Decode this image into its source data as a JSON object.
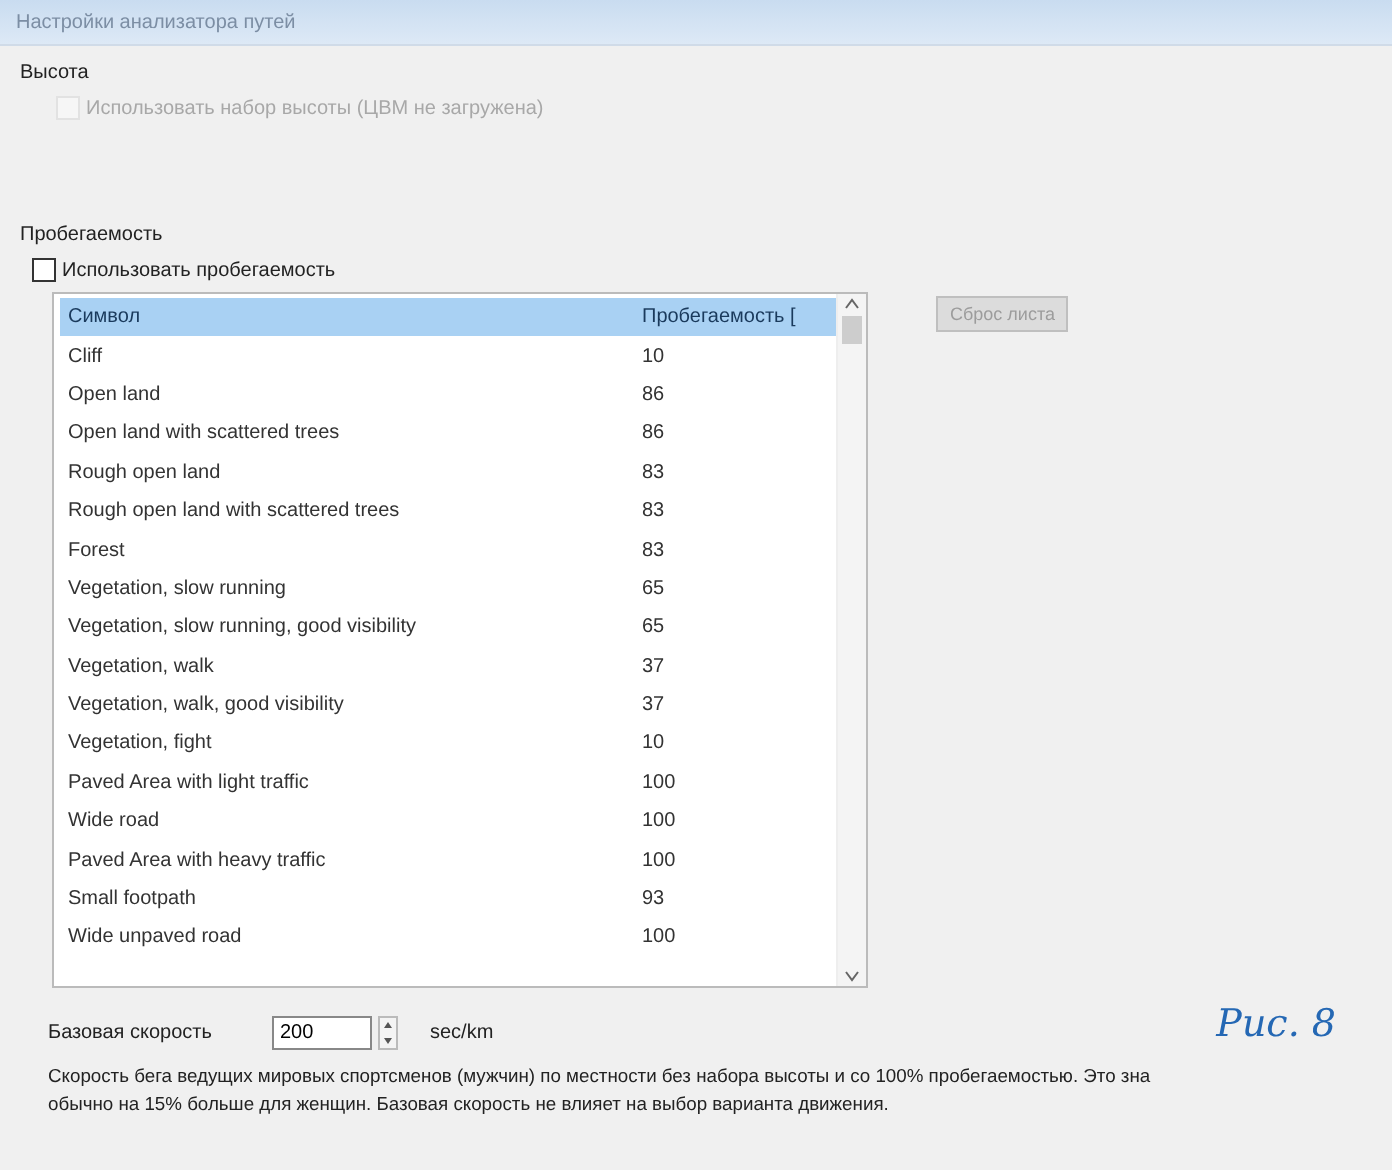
{
  "window": {
    "title": "Настройки анализатора путей"
  },
  "height_section": {
    "title": "Высота",
    "checkbox": {
      "label": "Использовать набор высоты (ЦВМ не загружена)",
      "checked": false,
      "disabled": true
    }
  },
  "runnability_section": {
    "title": "Пробегаемость",
    "checkbox": {
      "label": "Использовать пробегаемость",
      "checked": false,
      "disabled": false
    },
    "table": {
      "columns": [
        "Символ",
        "Пробегаемость ["
      ],
      "rows": [
        [
          "Cliff",
          "10"
        ],
        [
          "Open land",
          "86"
        ],
        [
          "Open land with scattered trees",
          "86"
        ],
        [
          "Rough open land",
          "83"
        ],
        [
          "Rough open land with scattered trees",
          "83"
        ],
        [
          "Forest",
          "83"
        ],
        [
          "Vegetation, slow running",
          "65"
        ],
        [
          "Vegetation, slow running, good visibility",
          "65"
        ],
        [
          "Vegetation, walk",
          "37"
        ],
        [
          "Vegetation, walk, good visibility",
          "37"
        ],
        [
          "Vegetation, fight",
          "10"
        ],
        [
          "Paved Area with light traffic",
          "100"
        ],
        [
          "Wide road",
          "100"
        ],
        [
          "Paved Area with heavy traffic",
          "100"
        ],
        [
          "Small footpath",
          "93"
        ],
        [
          "Wide unpaved road",
          "100"
        ]
      ]
    },
    "reset_button": {
      "label": "Сброс листа",
      "disabled": true
    }
  },
  "base_speed": {
    "label": "Базовая скорость",
    "value": "200",
    "unit": "sec/km"
  },
  "figure_caption": "Рис. 8",
  "description": [
    "Скорость бега ведущих мировых спортсменов (мужчин) по местности без набора высоты и со 100% пробегаемостью. Это зна",
    "обычно на 15% больше для женщин. Базовая скорость не влияет на выбор варианта движения."
  ]
}
